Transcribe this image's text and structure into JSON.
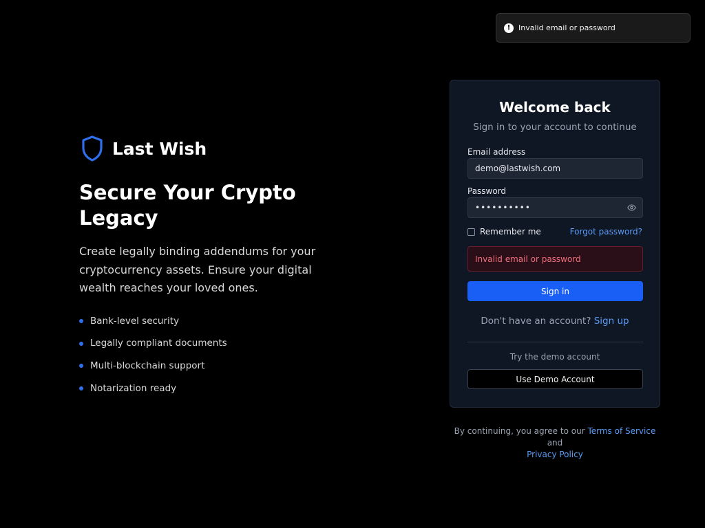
{
  "toast": {
    "icon": "alert-circle-icon",
    "message": "Invalid email or password"
  },
  "brand": {
    "logo_icon": "shield-icon",
    "name": "Last Wish",
    "accent": "#2f6fed"
  },
  "hero": {
    "headline": "Secure Your Crypto Legacy",
    "lede": "Create legally binding addendums for your cryptocurrency assets. Ensure your digital wealth reaches your loved ones.",
    "features": [
      "Bank-level security",
      "Legally compliant documents",
      "Multi-blockchain support",
      "Notarization ready"
    ]
  },
  "login": {
    "title": "Welcome back",
    "subtitle": "Sign in to your account to continue",
    "email_label": "Email address",
    "email_value": "demo@lastwish.com",
    "password_label": "Password",
    "password_masked": "••••••••••",
    "password_toggle_icon": "eye-icon",
    "remember_label": "Remember me",
    "remember_checked": false,
    "forgot_label": "Forgot password?",
    "error_message": "Invalid email or password",
    "submit_label": "Sign in",
    "no_account_text": "Don't have an account?",
    "signup_label": "Sign up",
    "demo_prompt": "Try the demo account",
    "demo_button_label": "Use Demo Account"
  },
  "legal": {
    "prefix": "By continuing, you agree to our",
    "terms_label": "Terms of Service",
    "and": "and",
    "privacy_label": "Privacy Policy"
  },
  "colors": {
    "primary": "#1a5ff5",
    "link": "#5b9bf5",
    "error_text": "#f26d7d",
    "error_bg": "#2a0f18",
    "card_bg": "#0f1624"
  }
}
